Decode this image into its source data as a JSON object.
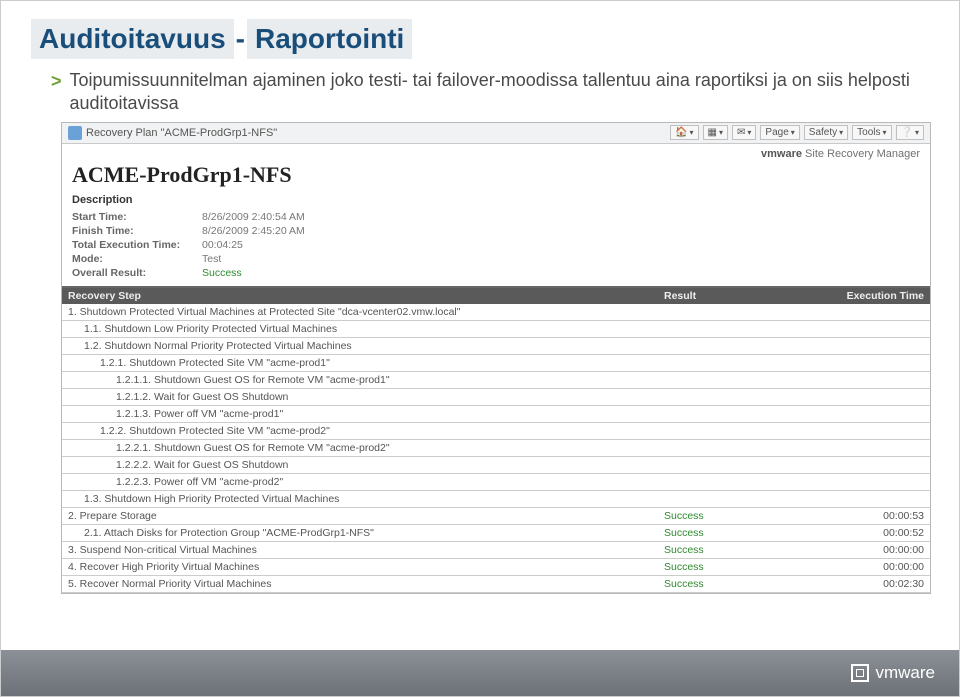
{
  "title_part1": "Auditoitavuus",
  "title_sep": " - ",
  "title_part2": "Raportointi",
  "bullet": "Toipumissuunnitelman ajaminen joko testi- tai failover-moodissa tallentuu aina raportiksi ja on siis helposti auditoitavissa",
  "ie": {
    "title": "Recovery Plan \"ACME-ProdGrp1-NFS\"",
    "page": "Page",
    "safety": "Safety",
    "tools": "Tools"
  },
  "srm_brand": "vmware",
  "srm_product": " Site Recovery Manager",
  "plan_title": "ACME-ProdGrp1-NFS",
  "desc_head": "Description",
  "meta": [
    {
      "label": "Start Time:",
      "val": "8/26/2009 2:40:54 AM"
    },
    {
      "label": "Finish Time:",
      "val": "8/26/2009 2:45:20 AM"
    },
    {
      "label": "Total Execution Time:",
      "val": "00:04:25"
    },
    {
      "label": "Mode:",
      "val": "Test"
    },
    {
      "label": "Overall Result:",
      "val": "Success",
      "success": true
    }
  ],
  "cols": {
    "step": "Recovery Step",
    "result": "Result",
    "time": "Execution Time"
  },
  "steps": [
    {
      "step": "1. Shutdown Protected Virtual Machines at Protected Site \"dca-vcenter02.vmw.local\"",
      "result": "",
      "time": "",
      "indent": 0
    },
    {
      "step": "1.1. Shutdown Low Priority Protected Virtual Machines",
      "result": "",
      "time": "",
      "indent": 1
    },
    {
      "step": "1.2. Shutdown Normal Priority Protected Virtual Machines",
      "result": "",
      "time": "",
      "indent": 1
    },
    {
      "step": "1.2.1. Shutdown Protected Site VM \"acme-prod1\"",
      "result": "",
      "time": "",
      "indent": 2
    },
    {
      "step": "1.2.1.1. Shutdown Guest OS for Remote VM \"acme-prod1\"",
      "result": "",
      "time": "",
      "indent": 3
    },
    {
      "step": "1.2.1.2. Wait for Guest OS Shutdown",
      "result": "",
      "time": "",
      "indent": 3
    },
    {
      "step": "1.2.1.3. Power off VM \"acme-prod1\"",
      "result": "",
      "time": "",
      "indent": 3
    },
    {
      "step": "1.2.2. Shutdown Protected Site VM \"acme-prod2\"",
      "result": "",
      "time": "",
      "indent": 2
    },
    {
      "step": "1.2.2.1. Shutdown Guest OS for Remote VM \"acme-prod2\"",
      "result": "",
      "time": "",
      "indent": 3
    },
    {
      "step": "1.2.2.2. Wait for Guest OS Shutdown",
      "result": "",
      "time": "",
      "indent": 3
    },
    {
      "step": "1.2.2.3. Power off VM \"acme-prod2\"",
      "result": "",
      "time": "",
      "indent": 3
    },
    {
      "step": "1.3. Shutdown High Priority Protected Virtual Machines",
      "result": "",
      "time": "",
      "indent": 1
    },
    {
      "step": "2. Prepare Storage",
      "result": "Success",
      "time": "00:00:53",
      "indent": 0
    },
    {
      "step": "2.1. Attach Disks for Protection Group \"ACME-ProdGrp1-NFS\"",
      "result": "Success",
      "time": "00:00:52",
      "indent": 1
    },
    {
      "step": "3. Suspend Non-critical Virtual Machines",
      "result": "Success",
      "time": "00:00:00",
      "indent": 0
    },
    {
      "step": "4. Recover High Priority Virtual Machines",
      "result": "Success",
      "time": "00:00:00",
      "indent": 0
    },
    {
      "step": "5. Recover Normal Priority Virtual Machines",
      "result": "Success",
      "time": "00:02:30",
      "indent": 0
    }
  ],
  "footer_logo": "vmware"
}
